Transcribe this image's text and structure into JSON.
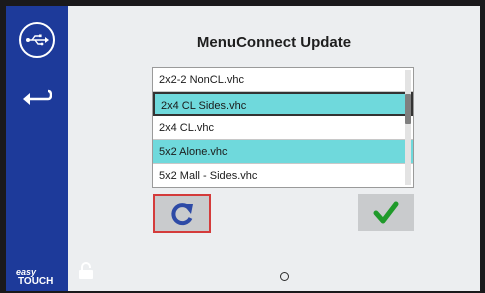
{
  "header": {
    "title": "MenuConnect Update"
  },
  "files": [
    {
      "label": "2x2-2 NonCL.vhc",
      "highlighted": false,
      "selected": false
    },
    {
      "label": "2x4 CL Sides.vhc",
      "highlighted": true,
      "selected": true
    },
    {
      "label": "2x4 CL.vhc",
      "highlighted": false,
      "selected": false
    },
    {
      "label": "5x2 Alone.vhc",
      "highlighted": true,
      "selected": false
    },
    {
      "label": "5x2 Mall - Sides.vhc",
      "highlighted": false,
      "selected": false
    }
  ],
  "sidebar": {
    "usb_icon": "usb-icon",
    "back_icon": "back-arrow-icon",
    "logo_line1": "easy",
    "logo_line2": "TOUCH"
  },
  "footer": {
    "lock_icon": "lock-icon",
    "page_indicator_icon": "page-dot-icon"
  },
  "actions": {
    "refresh_icon": "refresh-icon",
    "confirm_icon": "checkmark-icon"
  },
  "colors": {
    "sidebar": "#1d3a9a",
    "highlight": "#6fd9dc",
    "confirm": "#1f9a2a",
    "refresh_border": "#d43b3b",
    "refresh_icon": "#2d4aa6"
  }
}
